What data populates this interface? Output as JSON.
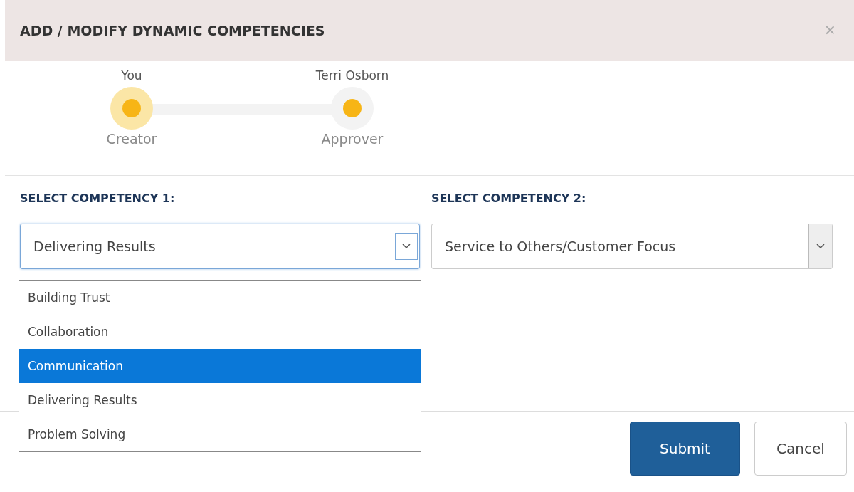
{
  "dialog": {
    "title": "ADD / MODIFY DYNAMIC COMPETENCIES",
    "close": "×"
  },
  "steps": [
    {
      "name": "You",
      "role": "Creator",
      "active": true
    },
    {
      "name": "Terri Osborn",
      "role": "Approver",
      "active": false
    }
  ],
  "selects": [
    {
      "label": "SELECT COMPETENCY 1:",
      "value": "Delivering Results",
      "open": true
    },
    {
      "label": "SELECT COMPETENCY 2:",
      "value": "Service to Others/Customer Focus",
      "open": false
    }
  ],
  "dropdown_options": [
    {
      "label": "Building Trust",
      "selected": false
    },
    {
      "label": "Collaboration",
      "selected": false
    },
    {
      "label": "Communication",
      "selected": true
    },
    {
      "label": "Delivering Results",
      "selected": false
    },
    {
      "label": "Problem Solving",
      "selected": false
    }
  ],
  "buttons": [
    {
      "label": "Submit",
      "kind": "primary"
    },
    {
      "label": "Cancel",
      "kind": "secondary"
    }
  ]
}
